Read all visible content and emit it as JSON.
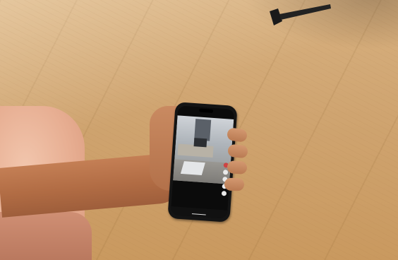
{
  "scene": {
    "description_tags": [
      "wood-floor",
      "hand-holding-phone",
      "phone-screen-video"
    ]
  },
  "colors": {
    "floor": "#cfa470",
    "skin": "#b9764c",
    "phone": "#141414"
  },
  "icons": {
    "side_actions": [
      "avatar-icon",
      "heart-icon",
      "comment-icon",
      "bookmark-icon",
      "share-icon"
    ],
    "stand": "tripod-leg-icon"
  }
}
